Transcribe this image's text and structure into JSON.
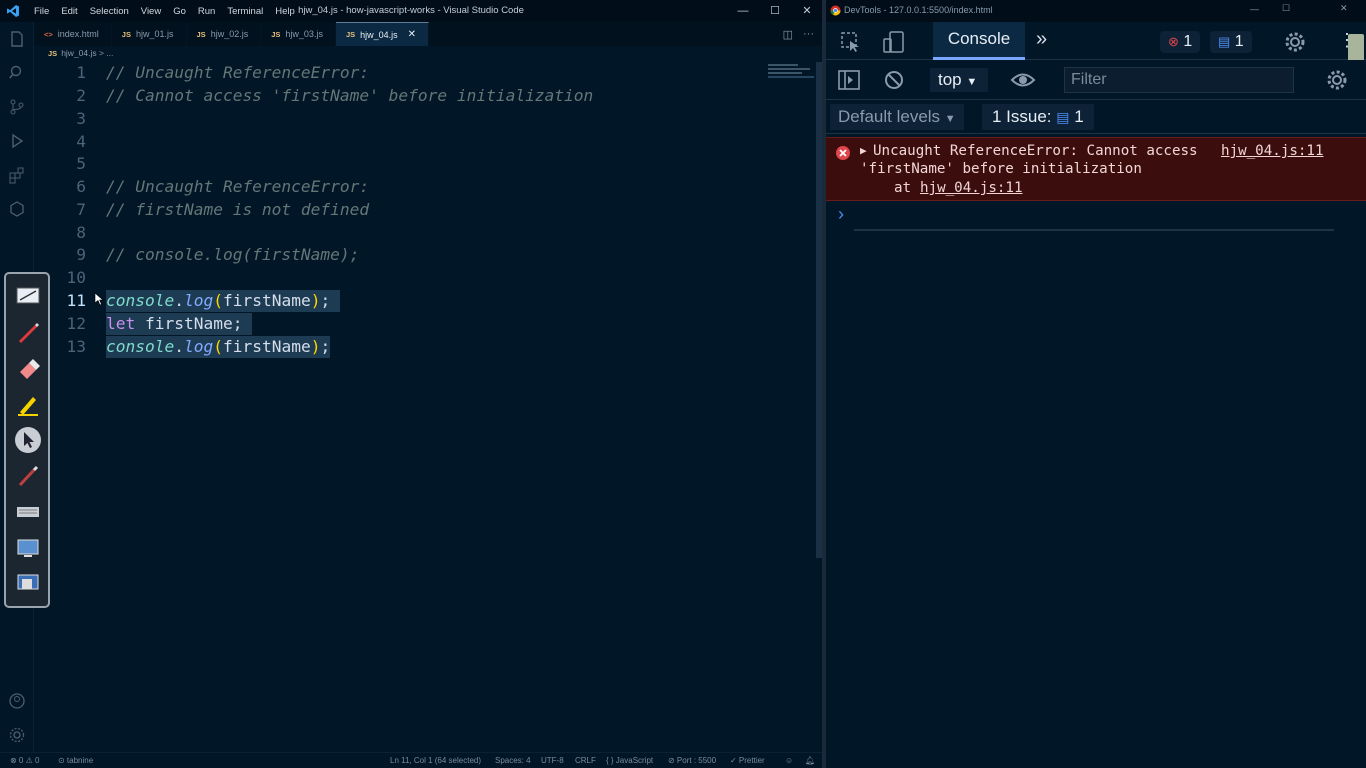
{
  "vscode": {
    "menu": [
      "File",
      "Edit",
      "Selection",
      "View",
      "Go",
      "Run",
      "Terminal",
      "Help"
    ],
    "window_title": "hjw_04.js - how-javascript-works - Visual Studio Code",
    "tabs": [
      {
        "icon": "<>",
        "label": "index.html",
        "active": false
      },
      {
        "icon": "JS",
        "label": "hjw_01.js",
        "active": false
      },
      {
        "icon": "JS",
        "label": "hjw_02.js",
        "active": false
      },
      {
        "icon": "JS",
        "label": "hjw_03.js",
        "active": false
      },
      {
        "icon": "JS",
        "label": "hjw_04.js",
        "active": true
      }
    ],
    "breadcrumb": {
      "icon": "JS",
      "file": "hjw_04.js",
      "sep": "> ..."
    },
    "lines": [
      {
        "n": "1",
        "text": "// Uncaught ReferenceError:"
      },
      {
        "n": "2",
        "text": "// Cannot access 'firstName' before initialization"
      },
      {
        "n": "3",
        "text": ""
      },
      {
        "n": "4",
        "text": ""
      },
      {
        "n": "5",
        "text": ""
      },
      {
        "n": "6",
        "text": "// Uncaught ReferenceError:"
      },
      {
        "n": "7",
        "text": "// firstName is not defined"
      },
      {
        "n": "8",
        "text": ""
      },
      {
        "n": "9",
        "text": "// console.log(firstName);"
      },
      {
        "n": "10",
        "text": ""
      },
      {
        "n": "11",
        "text": "console.log(firstName);"
      },
      {
        "n": "12",
        "text": "let firstName;"
      },
      {
        "n": "13",
        "text": "console.log(firstName);"
      }
    ],
    "code": {
      "console": "console",
      "dot": ".",
      "log": "log",
      "open": "(",
      "arg": "firstName",
      "close": ")",
      "semi": ";",
      "let": "let",
      "decl": " firstName;"
    },
    "status": {
      "errors": "⊗ 0 ⚠ 0",
      "tabnine": "⊙ tabnine",
      "cursor": "Ln 11, Col 1 (64 selected)",
      "spaces": "Spaces: 4",
      "encoding": "UTF-8",
      "eol": "CRLF",
      "language": "{ } JavaScript",
      "port": "⊘ Port : 5500",
      "prettier": "✓ Prettier"
    }
  },
  "devtools": {
    "window_title": "DevTools - 127.0.0.1:5500/index.html",
    "console_tab": "Console",
    "more_tabs": "»",
    "error_count": "1",
    "message_count": "1",
    "context": "top",
    "filter_placeholder": "Filter",
    "levels": "Default levels",
    "issues_label": "1 Issue:",
    "issues_count": "1",
    "error": {
      "line1": "Uncaught ReferenceError: Cannot access",
      "line2": "'firstName' before initialization",
      "at": "at",
      "source": "hjw_04.js:11",
      "source_link": "hjw_04.js:11"
    },
    "prompt": "›"
  },
  "colors": {
    "bg": "#011627",
    "comment": "#637777",
    "keyword": "#c792ea",
    "function": "#82aaff",
    "error_bg": "#3b0d0d",
    "accent": "#7aa7ff"
  }
}
